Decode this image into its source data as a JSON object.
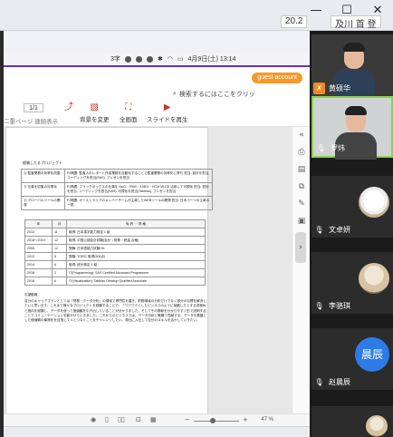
{
  "window": {
    "minimize_icon": "minimize-icon",
    "maximize_icon": "maximize-icon",
    "close_icon": "close-icon",
    "zoom_chip": "20.2",
    "app_chip": "及川 首 登"
  },
  "statusbar": {
    "input_indicator": "3字",
    "datetime": "4月9日(土) 13:14"
  },
  "viewer": {
    "guest_label": "guest account",
    "search_placeholder": "検索するにはここをクリッ",
    "page_current": "1/1",
    "toolbar_row2": "二重ページ  連続表示",
    "buttons": [
      {
        "label": "背景を変更",
        "icon": "background-icon"
      },
      {
        "label": "全画面",
        "icon": "fullscreen-icon"
      },
      {
        "label": "スライドを再生",
        "icon": "play-icon"
      }
    ],
    "zoom": "47 %"
  },
  "document": {
    "section_title": "経験したるプロジェクト",
    "projects": [
      {
        "name": "④ 監査業務の効率化改善",
        "desc": "PJ概要: 監査人のレポート作成業務を自動化することで監査業務の効率化に寄与 担当: 設計を担当, コーディングを担当(SAS), プレゼンを担当"
      },
      {
        "name": "⑤ 仕事を収集の可視化",
        "desc": "PJ概要: ブラックボックスの仕事を NoCl・RMX・KNEX・HCM MLCE 活用して可視化 担当: 設計を担当, コーディングを担当(SAS), 可視化を担当(Tableau), プレゼンを担当"
      },
      {
        "name": "⑥ グローバルツールの開発",
        "desc": "PJ概要: オーストラリアのメンバーチームが主導したWEBツールの開発 担当: 日本パーツの主導の一員"
      }
    ],
    "quals_header": [
      "年",
      "月",
      "免 許 ・ 資 格"
    ],
    "quals": [
      [
        "2013",
        "11",
        "取得:  日本漢字能力検定 1 級"
      ],
      [
        "2018〜2019",
        "12",
        "取得:  中国公認会計試験(会計・財務・税金 合格)"
      ],
      [
        "2005",
        "12",
        "受験:  日本語能力試験 N1"
      ],
      [
        "2013",
        "5",
        "受験:  TOEIC 取得(905点)"
      ],
      [
        "2014",
        "6",
        "取得:  統計検定 1 級"
      ],
      [
        "2016",
        "2",
        "IT(Programming): SAS Certified Advanced Programmer"
      ],
      [
        "2016",
        "6",
        "IT(Visualization): Tableau Desktop Qualified Associate"
      ]
    ],
    "essay_title": "志望動機",
    "essay": "自分のキャリアプランとしては「財務・データ分析」の領域で専門性を磨き、財務領域の分析だけでなく部分の目標を解決したいと思います。これまで様々なプロジェクトを経験することで、「ワクワクとしたビジネスのように接触したとする見極めと指向を経験し、データを使って価値観を引き出していることが分かりました。そしてその根幹を分かりやすく形で説明することでコミュニケーションを動かせていきました。これからのビジネスでは、データ分析と戦略で貢献する、データを基盤とした価値観の最適化を目指して人とつなぐことをチャレンジしたい。貴社に入社して自分のスキルを活かしていきたい。"
  },
  "participants": [
    {
      "name": "黄硕华",
      "mic": "muted",
      "kind": "initial-photo"
    },
    {
      "name": "罗炜",
      "mic": "on",
      "kind": "video"
    },
    {
      "name": "文卓妍",
      "mic": "on",
      "kind": "dog"
    },
    {
      "name": "李骆琪",
      "mic": "on",
      "kind": "cat"
    },
    {
      "name": "赵晨辰",
      "mic": "on",
      "kind": "initial",
      "initial": "晨辰"
    },
    {
      "name": "",
      "mic": "on",
      "kind": "partial"
    }
  ]
}
